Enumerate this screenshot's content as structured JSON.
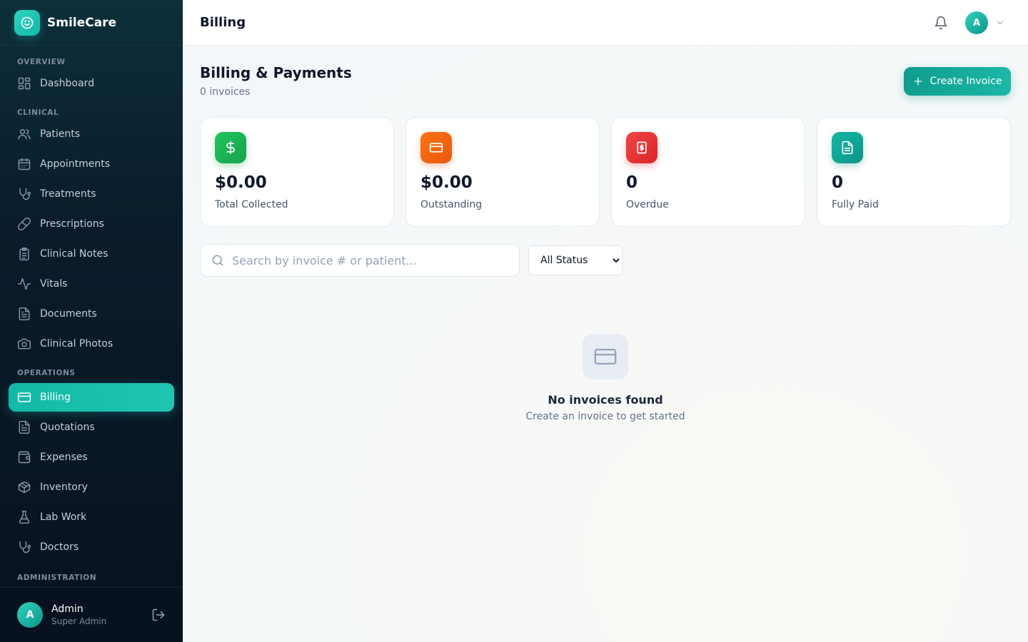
{
  "brand": {
    "name": "SmileCare",
    "logo_icon": "smile-icon"
  },
  "sidebar": {
    "sections": [
      {
        "label": "OVERVIEW",
        "items": [
          {
            "label": "Dashboard",
            "icon": "dashboard-icon"
          }
        ]
      },
      {
        "label": "CLINICAL",
        "items": [
          {
            "label": "Patients",
            "icon": "users-icon"
          },
          {
            "label": "Appointments",
            "icon": "calendar-icon"
          },
          {
            "label": "Treatments",
            "icon": "stethoscope-icon"
          },
          {
            "label": "Prescriptions",
            "icon": "pill-icon"
          },
          {
            "label": "Clinical Notes",
            "icon": "clipboard-icon"
          },
          {
            "label": "Vitals",
            "icon": "activity-icon"
          },
          {
            "label": "Documents",
            "icon": "file-icon"
          },
          {
            "label": "Clinical Photos",
            "icon": "camera-icon"
          }
        ]
      },
      {
        "label": "OPERATIONS",
        "items": [
          {
            "label": "Billing",
            "icon": "credit-card-icon",
            "active": true
          },
          {
            "label": "Quotations",
            "icon": "file-text-icon"
          },
          {
            "label": "Expenses",
            "icon": "wallet-icon"
          },
          {
            "label": "Inventory",
            "icon": "package-icon"
          },
          {
            "label": "Lab Work",
            "icon": "flask-icon"
          },
          {
            "label": "Doctors",
            "icon": "stethoscope-icon"
          }
        ]
      },
      {
        "label": "ADMINISTRATION",
        "items": []
      }
    ],
    "user": {
      "initial": "A",
      "name": "Admin",
      "role": "Super Admin"
    }
  },
  "header": {
    "title": "Billing",
    "avatar_initial": "A"
  },
  "page": {
    "title": "Billing & Payments",
    "subtitle": "0 invoices",
    "create_button": "Create Invoice"
  },
  "stats": [
    {
      "value": "$0.00",
      "label": "Total Collected",
      "icon": "dollar-icon",
      "color": "#16a34a"
    },
    {
      "value": "$0.00",
      "label": "Outstanding",
      "icon": "credit-card-icon",
      "color": "#ea580c"
    },
    {
      "value": "0",
      "label": "Overdue",
      "icon": "receipt-icon",
      "color": "#dc2626"
    },
    {
      "value": "0",
      "label": "Fully Paid",
      "icon": "file-text-icon",
      "color": "#0d9488"
    }
  ],
  "filters": {
    "search_placeholder": "Search by invoice # or patient...",
    "status_selected": "All Status"
  },
  "empty_state": {
    "icon": "credit-card-icon",
    "title": "No invoices found",
    "subtitle": "Create an invoice to get started"
  },
  "colors": {
    "accent": "#14b8a6",
    "sidebar_bg": "#0a1c2b"
  }
}
